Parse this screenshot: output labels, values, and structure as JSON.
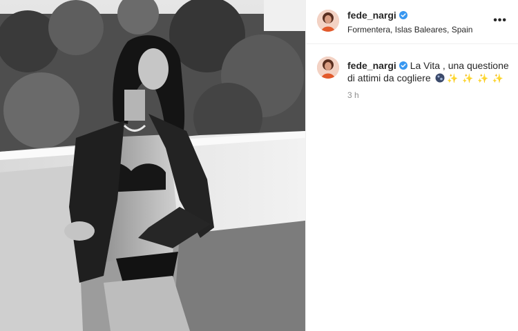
{
  "post": {
    "username": "fede_nargi",
    "location": "Formentera, Islas Baleares, Spain",
    "more_label": "•••",
    "caption_text": "La Vita , una questione di attimi da cogliere",
    "caption_emoji": "✨ ✨ ✨ ✨",
    "timestamp": "3 h"
  },
  "icons": {
    "verified": "verified-badge-icon",
    "more": "more-options-icon",
    "globe": "globe-emoji-icon",
    "sparkles": "sparkles-emoji-icon"
  },
  "colors": {
    "verified_blue": "#3897f0",
    "secondary_text": "#8e8e8e",
    "divider": "#efefef"
  }
}
